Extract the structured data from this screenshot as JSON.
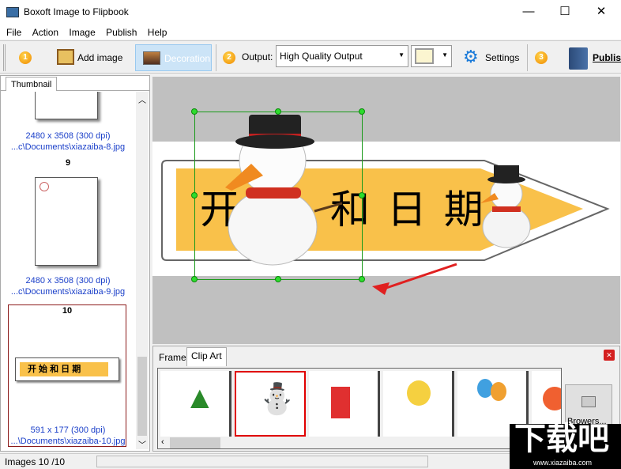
{
  "window": {
    "title": "Boxoft Image to Flipbook",
    "minimize": "—",
    "maximize": "☐",
    "close": "✕"
  },
  "menu": [
    "File",
    "Action",
    "Image",
    "Publish",
    "Help"
  ],
  "toolbar": {
    "step1": "1",
    "add_image": "Add image",
    "decoration": "Decoration",
    "step2": "2",
    "output_label": "Output:",
    "output_value": "High Quality Output",
    "settings": "Settings",
    "step3": "3",
    "publish": "Publish"
  },
  "left_panel": {
    "tab": "Thumbnail",
    "items": [
      {
        "number": "",
        "size": "2480 x 3508 (300 dpi)",
        "path": "...c\\Documents\\xiazaiba-8.jpg"
      },
      {
        "number": "9",
        "size": "2480 x 3508 (300 dpi)",
        "path": "...c\\Documents\\xiazaiba-9.jpg"
      },
      {
        "number": "10",
        "size": "591 x 177 (300 dpi)",
        "path": "...\\Documents\\xiazaiba-10.jpg",
        "banner_text": "开 始 和 日 期"
      }
    ]
  },
  "canvas": {
    "banner_text": "开始和日期",
    "visible_text_left": "开",
    "visible_text_right": "和 日 期"
  },
  "bottom_panel": {
    "tabs": [
      "Frame",
      "Clip Art"
    ],
    "active_tab": "Clip Art",
    "clipart": [
      "christmas-tree",
      "snowman",
      "happy-balloons",
      "chick-cloud",
      "balloons",
      "rose"
    ],
    "browse": "Browers..."
  },
  "status": {
    "text": "Images 10 /10"
  },
  "watermark": {
    "text": "下载吧",
    "url": "www.xiazaiba.com"
  },
  "colors": {
    "selection": "#2ddc2d",
    "banner": "#f9c14a",
    "arrow": "#e02020"
  }
}
